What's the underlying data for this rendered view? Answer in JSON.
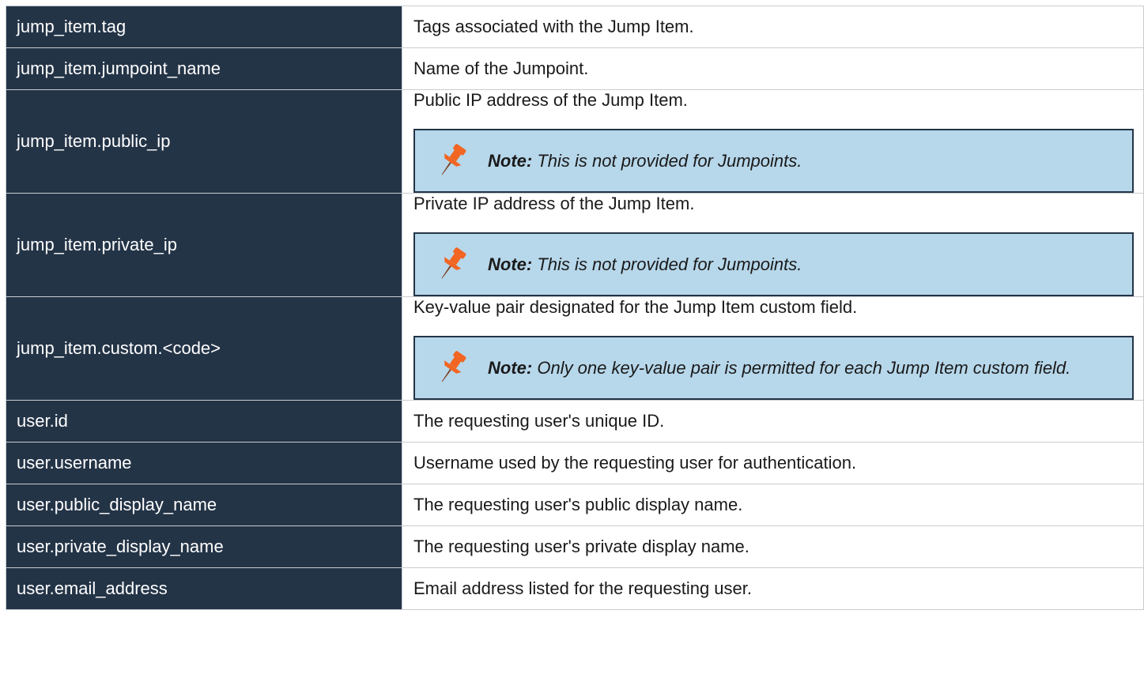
{
  "rows": [
    {
      "key": "jump_item.tag",
      "desc": "Tags associated with the Jump Item."
    },
    {
      "key": "jump_item.jumpoint_name",
      "desc": "Name of the Jumpoint."
    },
    {
      "key": "jump_item.public_ip",
      "desc": "Public IP address of the Jump Item.",
      "note_label": "Note:",
      "note_text": " This is not provided for Jumpoints."
    },
    {
      "key": "jump_item.private_ip",
      "desc": "Private IP address of the Jump Item.",
      "note_label": "Note:",
      "note_text": " This is not provided for Jumpoints."
    },
    {
      "key": "jump_item.custom.<code>",
      "desc": "Key-value pair designated for the Jump Item custom field.",
      "note_label": "Note:",
      "note_text": " Only one key-value pair is permitted for each Jump Item custom field."
    },
    {
      "key": "user.id",
      "desc": "The requesting user's unique ID."
    },
    {
      "key": "user.username",
      "desc": "Username used by the requesting user for authentication."
    },
    {
      "key": "user.public_display_name",
      "desc": "The requesting user's public display name."
    },
    {
      "key": "user.private_display_name",
      "desc": "The requesting user's private display name."
    },
    {
      "key": "user.email_address",
      "desc": "Email address listed for the requesting user."
    }
  ],
  "icons": {
    "note": "pushpin-icon"
  },
  "colors": {
    "key_bg": "#243447",
    "note_bg": "#b7d7ea",
    "pin": "#f26522"
  }
}
